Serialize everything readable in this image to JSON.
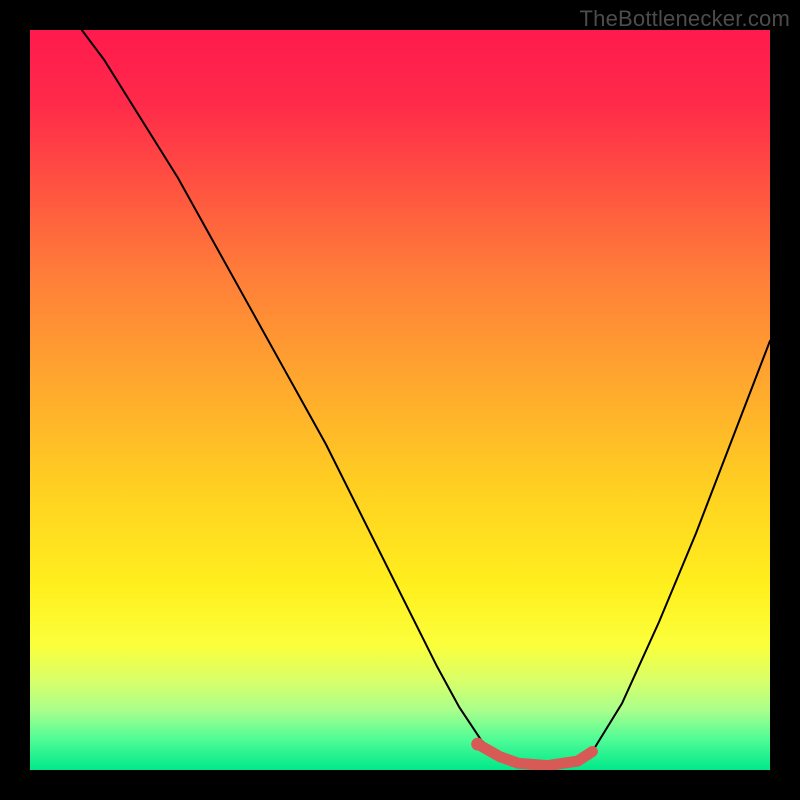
{
  "watermark": "TheBottlenecker.com",
  "colors": {
    "curve": "#000000",
    "highlight": "#d85a56",
    "frame": "#000000"
  },
  "chart_data": {
    "type": "line",
    "title": "",
    "xlabel": "",
    "ylabel": "",
    "xlim": [
      0,
      100
    ],
    "ylim": [
      0,
      100
    ],
    "series": [
      {
        "name": "left-branch",
        "x": [
          7,
          10,
          15,
          20,
          25,
          30,
          35,
          40,
          45,
          50,
          55,
          58,
          61,
          63.5
        ],
        "y": [
          100,
          96,
          88,
          80,
          71,
          62,
          53,
          44,
          34,
          24,
          14,
          8.5,
          4,
          1.8
        ]
      },
      {
        "name": "valley-floor",
        "x": [
          63.5,
          66,
          70,
          74,
          76
        ],
        "y": [
          1.8,
          0.9,
          0.6,
          1.2,
          2.5
        ]
      },
      {
        "name": "right-branch",
        "x": [
          76,
          80,
          85,
          90,
          95,
          100
        ],
        "y": [
          2.5,
          9,
          20,
          32,
          45,
          58
        ]
      }
    ],
    "highlight": {
      "name": "optimal-range",
      "x": [
        60.5,
        63.5,
        66,
        70,
        74,
        76
      ],
      "y": [
        3.5,
        1.8,
        0.9,
        0.6,
        1.2,
        2.5
      ]
    },
    "annotations": []
  }
}
